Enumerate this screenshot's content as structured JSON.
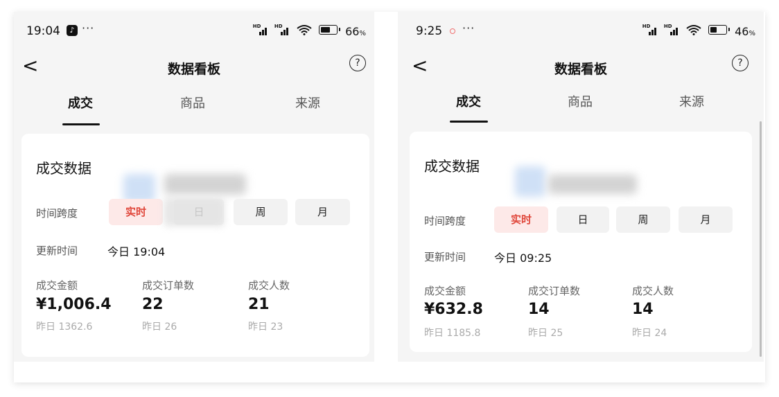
{
  "screens": [
    {
      "status": {
        "time": "19:04",
        "dots": "···",
        "battery_percent": "66",
        "battery_level": 0.66
      },
      "nav": {
        "back": "<",
        "title": "数据看板",
        "help": "?"
      },
      "tabs": [
        {
          "label": "成交",
          "active": true
        },
        {
          "label": "商品",
          "active": false
        },
        {
          "label": "来源",
          "active": false
        }
      ],
      "card": {
        "title": "成交数据",
        "time_span_label": "时间跨度",
        "segments": [
          "实时",
          "日",
          "周",
          "月"
        ],
        "selected_segment": "实时",
        "update_label": "更新时间",
        "update_value": "今日 19:04",
        "metrics": [
          {
            "label": "成交金额",
            "value": "¥1,006.4",
            "prev": "昨日 1362.6"
          },
          {
            "label": "成交订单数",
            "value": "22",
            "prev": "昨日 26"
          },
          {
            "label": "成交人数",
            "value": "21",
            "prev": "昨日 23"
          }
        ]
      }
    },
    {
      "status": {
        "time": "9:25",
        "dots": "···",
        "battery_percent": "46",
        "battery_level": 0.46
      },
      "nav": {
        "back": "<",
        "title": "数据看板",
        "help": "?"
      },
      "tabs": [
        {
          "label": "成交",
          "active": true
        },
        {
          "label": "商品",
          "active": false
        },
        {
          "label": "来源",
          "active": false
        }
      ],
      "card": {
        "title": "成交数据",
        "time_span_label": "时间跨度",
        "segments": [
          "实时",
          "日",
          "周",
          "月"
        ],
        "selected_segment": "实时",
        "update_label": "更新时间",
        "update_value": "今日 09:25",
        "metrics": [
          {
            "label": "成交金额",
            "value": "¥632.8",
            "prev": "昨日 1185.8"
          },
          {
            "label": "成交订单数",
            "value": "14",
            "prev": "昨日 25"
          },
          {
            "label": "成交人数",
            "value": "14",
            "prev": "昨日 24"
          }
        ]
      }
    }
  ],
  "status_icons": {
    "signal": "signal-hd-icon",
    "wifi": "wifi-icon",
    "battery": "battery-icon",
    "notification_app": "douyin-app-icon"
  },
  "colors": {
    "accent_red": "#e0473b",
    "accent_red_bg": "#fde9e8",
    "page_bg": "#f5f5f5",
    "card_bg": "#ffffff"
  }
}
